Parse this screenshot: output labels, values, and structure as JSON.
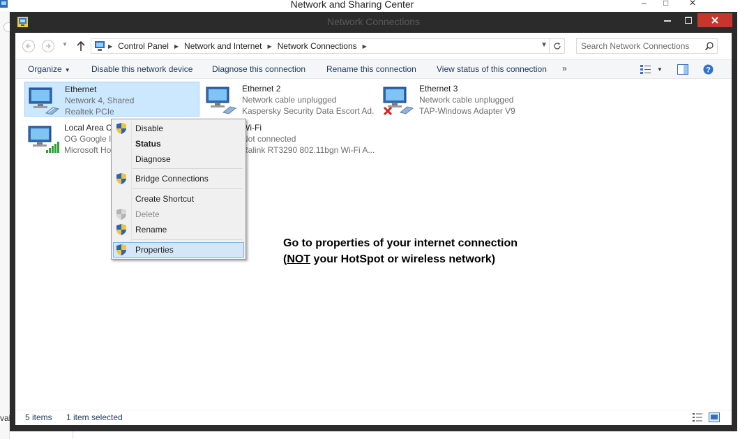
{
  "background_window": {
    "title": "Network and Sharing Center",
    "left_text": "vab",
    "controls": {
      "minimize": "–",
      "maximize": "□",
      "close": "✕"
    }
  },
  "window": {
    "title": "Network Connections",
    "controls": {
      "minimize": "—",
      "maximize": "□",
      "close": "✕"
    }
  },
  "address_bar": {
    "crumbs": [
      "Control Panel",
      "Network and Internet",
      "Network Connections"
    ]
  },
  "search": {
    "placeholder": "Search Network Connections"
  },
  "command_bar": {
    "organize": "Organize",
    "disable_device": "Disable this network device",
    "diagnose": "Diagnose this connection",
    "rename": "Rename this connection",
    "view_status": "View status of this connection",
    "more": "»"
  },
  "connections": [
    {
      "name": "Ethernet",
      "status": "Network  4, Shared",
      "adapter": "Realtek PCIe",
      "selected": true,
      "icon": "ethernet-icon"
    },
    {
      "name": "Ethernet 2",
      "status": "Network cable unplugged",
      "adapter": "Kaspersky Security Data Escort Ad...",
      "selected": false,
      "icon": "ethernet-icon"
    },
    {
      "name": "Ethernet 3",
      "status": "Network cable unplugged",
      "adapter": "TAP-Windows Adapter V9",
      "selected": false,
      "icon": "ethernet-disconnected-icon"
    },
    {
      "name": "Local Area C",
      "status": "OG Google I",
      "adapter": "Microsoft Ho",
      "selected": false,
      "icon": "wireless-signal-icon"
    },
    {
      "name": "Wi-Fi",
      "status": "Not connected",
      "adapter": "Ralink RT3290 802.11bgn Wi-Fi A...",
      "selected": false,
      "icon": "wifi-icon"
    }
  ],
  "context_menu": {
    "items": [
      {
        "label": "Disable",
        "shield": true,
        "bold": false,
        "disabled": false
      },
      {
        "label": "Status",
        "shield": false,
        "bold": true,
        "disabled": false
      },
      {
        "label": "Diagnose",
        "shield": false,
        "bold": false,
        "disabled": false
      },
      {
        "label": "Bridge Connections",
        "shield": true,
        "bold": false,
        "disabled": false
      },
      {
        "label": "Create Shortcut",
        "shield": false,
        "bold": false,
        "disabled": false
      },
      {
        "label": "Delete",
        "shield": true,
        "bold": false,
        "disabled": true
      },
      {
        "label": "Rename",
        "shield": true,
        "bold": false,
        "disabled": false
      },
      {
        "label": "Properties",
        "shield": true,
        "bold": false,
        "disabled": false,
        "highlighted": true
      }
    ]
  },
  "annotation": {
    "line1": "Go to properties of your internet connection",
    "line2_open": "(",
    "line2_underlined": "NOT",
    "line2_rest": " your HotSpot or wireless network)"
  },
  "status_bar": {
    "count": "5 items",
    "selected": "1 item selected"
  },
  "colors": {
    "frame": "#2b2b2b",
    "close_button": "#c7362c",
    "selection": "#cce8ff",
    "link_text": "#1e395b"
  }
}
